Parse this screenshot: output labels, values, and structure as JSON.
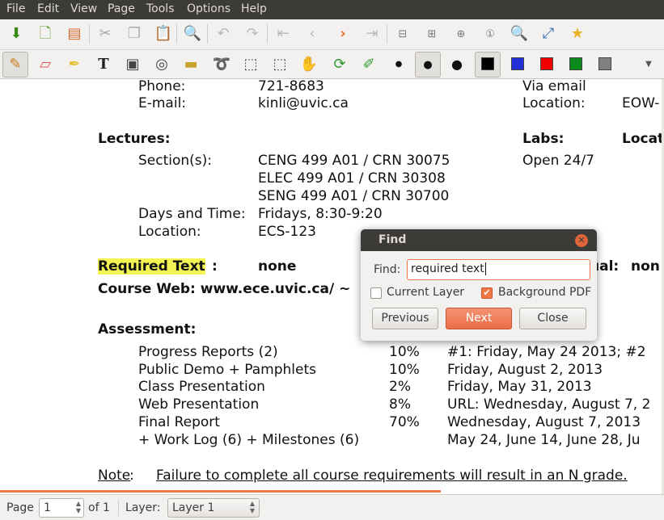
{
  "menu": [
    "File",
    "Edit",
    "View",
    "Page",
    "Tools",
    "Options",
    "Help"
  ],
  "toolbar": {
    "icons": [
      "save-icon",
      "new-page-icon",
      "open-icon",
      "cut-icon",
      "copy-icon",
      "paste-icon",
      "search-icon",
      "undo-icon",
      "redo-icon",
      "first-page-icon",
      "prev-page-icon",
      "next-page-icon",
      "last-page-icon",
      "zoom-out-icon",
      "zoom-fit-icon",
      "zoom-in-icon",
      "zoom-normal-icon",
      "zoom-icon",
      "fullscreen-icon",
      "bookmark-star-icon"
    ]
  },
  "tools": {
    "pen": "pen-icon",
    "eraser": "eraser-icon",
    "highlighter": "highlighter-icon",
    "text_symbol": "T",
    "colors": [
      "#000000",
      "#2230d8",
      "#f20000",
      "#0b8a1c",
      "#808080"
    ]
  },
  "document": {
    "phone_label": "Phone:",
    "phone_value": "721-8683",
    "via": "Via email",
    "email_label": "E-mail:",
    "email_value": "kinli@uvic.ca",
    "location_label_r": "Location:",
    "location_value_r": "EOW-",
    "lectures": "Lectures:",
    "labs": "Labs:",
    "locat": "Locat",
    "sections_label": "Section(s):",
    "open": "Open 24/7",
    "sections": [
      "CENG 499 A01 / CRN 30075",
      "ELEC 499 A01 / CRN 30308",
      "SENG 499 A01 / CRN 30700"
    ],
    "days_label": "Days and Time:",
    "days_value": "Fridays, 8:30-9:20",
    "location_label": "Location:",
    "location_value": "ECS-123",
    "required_text": "Required Text",
    "colon": ":",
    "none": "none",
    "ual": "ual:",
    "none2": "non",
    "course_web": "Course Web: www.ece.uvic.ca/ ~",
    "assessment": "Assessment:",
    "rows": [
      {
        "item": "Progress Reports (2)",
        "pct": "10%",
        "date": "#1: Friday, May 24 2013; #2"
      },
      {
        "item": "Public Demo + Pamphlets",
        "pct": "10%",
        "date": "Friday, August 2, 2013"
      },
      {
        "item": "Class Presentation",
        "pct": "2%",
        "date": "Friday, May 31, 2013"
      },
      {
        "item": "Web Presentation",
        "pct": "8%",
        "date": "URL: Wednesday, August 7, 2"
      },
      {
        "item": "Final Report",
        "pct": "70%",
        "date": "Wednesday, August 7, 2013"
      },
      {
        "item": "+ Work Log (6) + Milestones (6)",
        "pct": "",
        "date": "May 24, June 14, June 28, Ju"
      }
    ],
    "note_label": "Note",
    "note_colon": ":",
    "note_text": "Failure to complete all course requirements will result in an N grade."
  },
  "find_dialog": {
    "title": "Find",
    "find_label": "Find:",
    "find_value": "required text",
    "current_layer": "Current Layer",
    "current_layer_checked": false,
    "background_pdf": "Background PDF",
    "background_pdf_checked": true,
    "previous": "Previous",
    "next": "Next",
    "close": "Close"
  },
  "status": {
    "page_label": "Page",
    "page_value": "1",
    "of": "of 1",
    "layer_label": "Layer:",
    "layer_value": "Layer 1"
  }
}
